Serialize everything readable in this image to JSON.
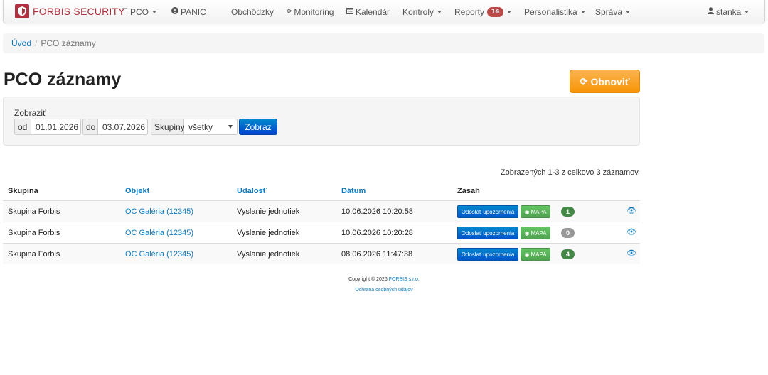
{
  "brand": {
    "name": "FORBIS SECURITY"
  },
  "nav": {
    "pco": "PCO",
    "panic": "PANIC",
    "rounds": "Obchôdzky",
    "monitoring": "Monitoring",
    "calendar": "Kalendár",
    "checks": "Kontroly",
    "reports": "Reporty",
    "reports_badge": "14",
    "personnel": "Personalistika",
    "admin": "Správa",
    "user": "stanka"
  },
  "breadcrumb": {
    "home": "Úvod",
    "separator": "/",
    "current": "PCO záznamy"
  },
  "page": {
    "title": "PCO záznamy",
    "refresh_label": "Obnoviť"
  },
  "filter": {
    "label": "Zobraziť",
    "from_label": "od",
    "from_value": "01.01.2026",
    "to_label": "do",
    "to_value": "03.07.2026",
    "groups_label": "Skupiny",
    "groups_value": "všetky",
    "show_label": "Zobraz"
  },
  "summary": "Zobrazených 1-3 z celkovo 3 záznamov.",
  "table": {
    "headers": {
      "group": "Skupina",
      "object": "Objekt",
      "event": "Udalosť",
      "date": "Dátum",
      "action": "Zásah"
    },
    "rows": [
      {
        "group": "Skupina Forbis",
        "object": "OC Galéria (12345)",
        "event": "Vyslanie jednotiek",
        "date": "10.06.2026 10:20:58",
        "notify": "Odoslať upozornenia",
        "map": "MAPA",
        "count": "1",
        "count_color": "#468847"
      },
      {
        "group": "Skupina Forbis",
        "object": "OC Galéria (12345)",
        "event": "Vyslanie jednotiek",
        "date": "10.06.2026 10:20:28",
        "notify": "Odoslať upozornenia",
        "map": "MAPA",
        "count": "0",
        "count_color": "#999999"
      },
      {
        "group": "Skupina Forbis",
        "object": "OC Galéria (12345)",
        "event": "Vyslanie jednotiek",
        "date": "08.06.2026 11:47:38",
        "notify": "Odoslať upozornenia",
        "map": "MAPA",
        "count": "4",
        "count_color": "#468847"
      }
    ]
  },
  "footer": {
    "copyright": "Copyright © 2026",
    "company": "FORBIS s.r.o.",
    "privacy": "Ochrana osobných údajov"
  },
  "colors": {
    "brand": "#b0303f",
    "link": "#0f7bbf",
    "warning": "#f89406",
    "primary": "#0055cc",
    "success": "#51a351"
  }
}
